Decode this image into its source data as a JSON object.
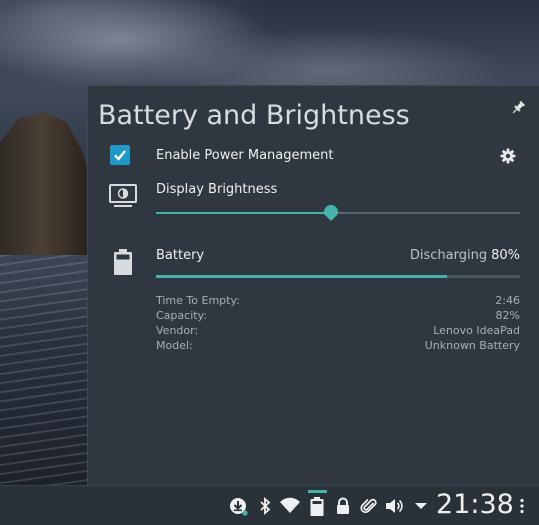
{
  "popup": {
    "title": "Battery and Brightness",
    "power_management": {
      "label": "Enable Power Management",
      "checked": true
    },
    "brightness": {
      "label": "Display Brightness",
      "value_fraction": 0.48
    },
    "battery": {
      "label": "Battery",
      "status": "Discharging",
      "percent_text": "80%",
      "charge_fraction": 0.8,
      "details": [
        {
          "key": "Time To Empty:",
          "value": "2:46"
        },
        {
          "key": "Capacity:",
          "value": "82%"
        },
        {
          "key": "Vendor:",
          "value": "Lenovo IdeaPad"
        },
        {
          "key": "Model:",
          "value": "Unknown Battery"
        }
      ]
    }
  },
  "panel": {
    "clock": "21:38",
    "tray_icons": [
      "updates-icon",
      "bluetooth-icon",
      "wifi-icon",
      "battery-tray-icon",
      "lock-icon",
      "clipboard-icon",
      "volume-icon",
      "expand-tray-icon"
    ]
  },
  "colors": {
    "accent": "#45b3aa",
    "check": "#1e99c8",
    "popup_bg": "#2f3840",
    "panel_bg": "#2a3239"
  }
}
